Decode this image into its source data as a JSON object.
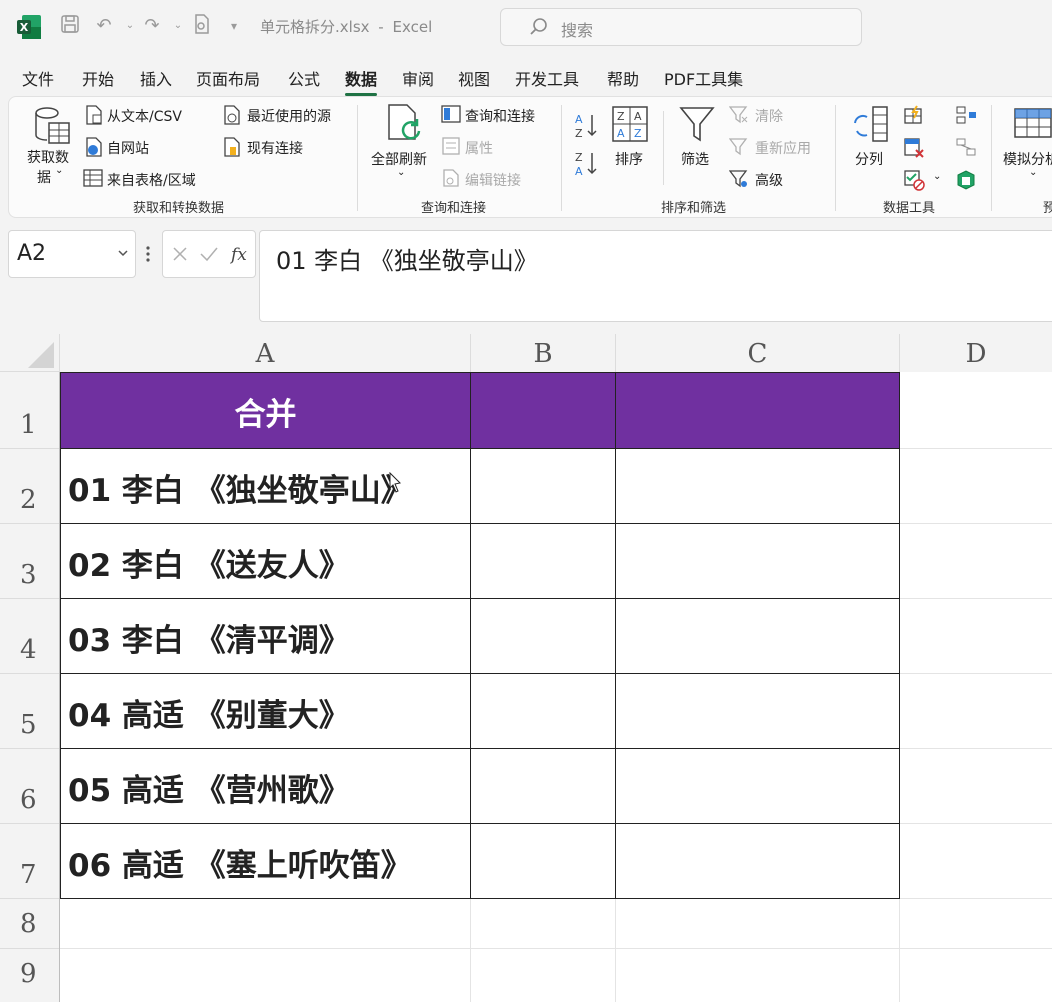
{
  "window": {
    "file_name": "单元格拆分.xlsx",
    "separator": "-",
    "app_name": "Excel",
    "search_placeholder": "搜索"
  },
  "menu_tabs": [
    "文件",
    "开始",
    "插入",
    "页面布局",
    "公式",
    "数据",
    "审阅",
    "视图",
    "开发工具",
    "帮助",
    "PDF工具集"
  ],
  "active_tab": "数据",
  "ribbon": {
    "get_data": {
      "big_button_line1": "获取数",
      "big_button_line2": "据",
      "from_text_csv": "从文本/CSV",
      "from_web": "自网站",
      "from_table": "来自表格/区域",
      "recent_sources": "最近使用的源",
      "existing_connections": "现有连接",
      "group_label": "获取和转换数据"
    },
    "queries": {
      "refresh_all": "全部刷新",
      "queries_connections": "查询和连接",
      "properties": "属性",
      "edit_links": "编辑链接",
      "group_label": "查询和连接"
    },
    "sort_filter": {
      "sort": "排序",
      "filter": "筛选",
      "clear": "清除",
      "reapply": "重新应用",
      "advanced": "高级",
      "group_label": "排序和筛选"
    },
    "data_tools": {
      "text_to_columns": "分列",
      "group_label": "数据工具"
    },
    "forecast": {
      "what_if": "模拟分析",
      "group_label_partial": "预"
    }
  },
  "name_box": "A2",
  "formula_bar": "01 李白 《独坐敬亭山》",
  "columns": [
    "A",
    "B",
    "C",
    "D"
  ],
  "rows": [
    "1",
    "2",
    "3",
    "4",
    "5",
    "6",
    "7",
    "8",
    "9"
  ],
  "cells": {
    "header": "合并",
    "items": [
      "01 李白 《独坐敬亭山》",
      "02 李白 《送友人》",
      "03 李白 《清平调》",
      "04 高适 《别董大》",
      "05 高适 《营州歌》",
      "06 高适 《塞上听吹笛》"
    ]
  },
  "colors": {
    "header_fill": "#7030a0",
    "excel_green": "#1f7244"
  }
}
